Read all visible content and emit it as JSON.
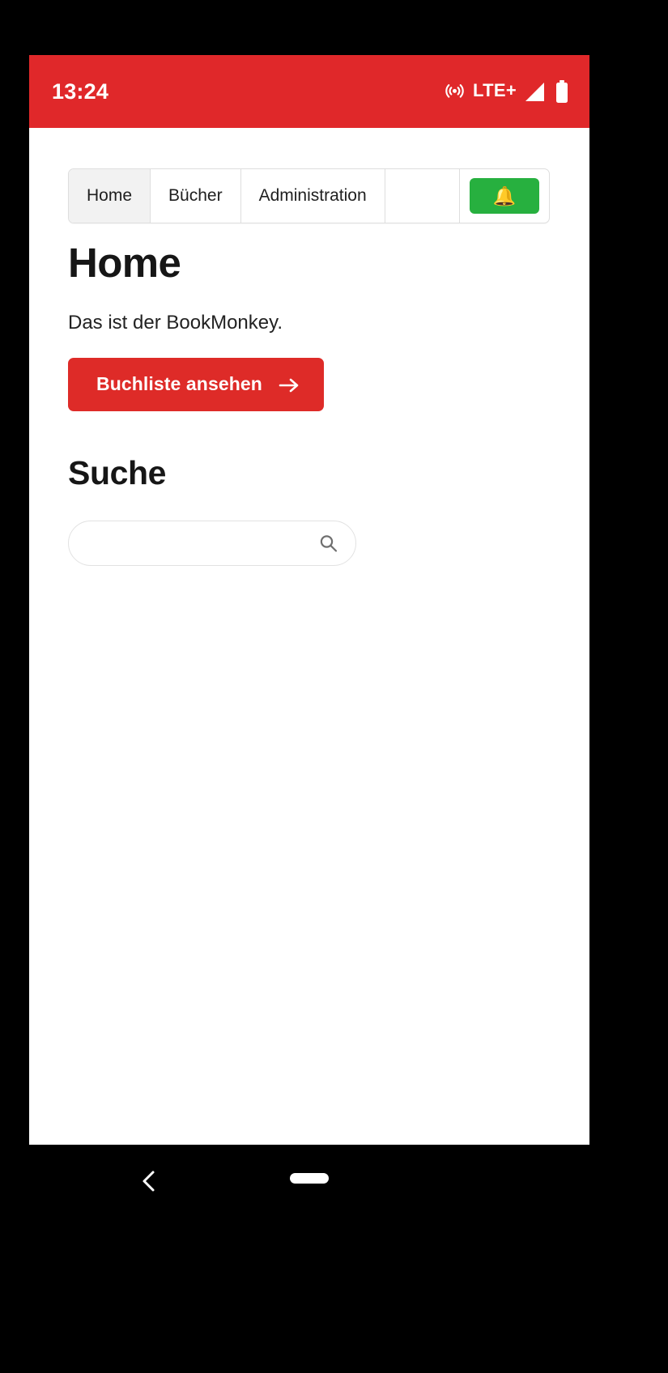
{
  "status_bar": {
    "time": "13:24",
    "network_label": "LTE+",
    "icons": [
      "hotspot-icon",
      "signal-icon",
      "battery-icon"
    ],
    "background_color": "#e0282a",
    "text_color": "#ffffff"
  },
  "nav": {
    "items": [
      {
        "label": "Home",
        "active": true
      },
      {
        "label": "Bücher",
        "active": false
      },
      {
        "label": "Administration",
        "active": false
      }
    ],
    "action": {
      "icon": "bell-icon",
      "glyph": "🔔",
      "background_color": "#27b03f"
    }
  },
  "main": {
    "title": "Home",
    "lead": "Das ist der BookMonkey.",
    "cta": {
      "label": "Buchliste ansehen",
      "icon": "arrow-right-icon",
      "background_color": "#de2b28"
    },
    "search_section": {
      "title": "Suche",
      "input_value": "",
      "input_placeholder": "",
      "icon": "search-icon"
    }
  },
  "system_nav": {
    "back": "back-chevron-icon",
    "home": "home-pill-indicator"
  }
}
